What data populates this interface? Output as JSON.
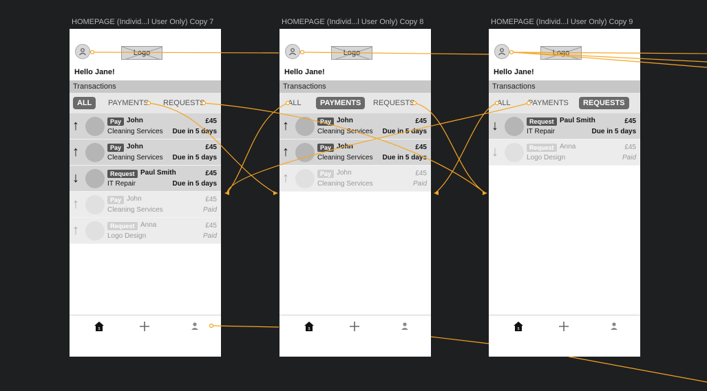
{
  "screens": [
    {
      "title": "HOMEPAGE (Individ...l User Only)  Copy 7",
      "logo": "Logo",
      "greeting": "Hello Jane!",
      "section": "Transactions",
      "tabs": [
        "ALL",
        "PAYMENTS",
        "REQUESTS"
      ],
      "active_tab": "ALL",
      "rows": [
        {
          "direction": "up",
          "type": "Pay",
          "name": "John",
          "service": "Cleaning Services",
          "amount": "£45",
          "status": "Due in 5 days",
          "muted": false
        },
        {
          "direction": "up",
          "type": "Pay",
          "name": "John",
          "service": "Cleaning Services",
          "amount": "£45",
          "status": "Due in 5 days",
          "muted": false
        },
        {
          "direction": "down",
          "type": "Request",
          "name": "Paul Smith",
          "service": "IT Repair",
          "amount": "£45",
          "status": "Due in 5 days",
          "muted": false
        },
        {
          "direction": "up",
          "type": "Pay",
          "name": "John",
          "service": "Cleaning Services",
          "amount": "£45",
          "status": "Paid",
          "muted": true
        },
        {
          "direction": "up",
          "type": "Request",
          "name": "Anna",
          "service": "Logo Design",
          "amount": "£45",
          "status": "Paid",
          "muted": true
        }
      ]
    },
    {
      "title": "HOMEPAGE (Individ...l User Only)  Copy 8",
      "logo": "Logo",
      "greeting": "Hello Jane!",
      "section": "Transactions",
      "tabs": [
        "ALL",
        "PAYMENTS",
        "REQUESTS"
      ],
      "active_tab": "PAYMENTS",
      "rows": [
        {
          "direction": "up",
          "type": "Pay",
          "name": "John",
          "service": "Cleaning Services",
          "amount": "£45",
          "status": "Due in 5 days",
          "muted": false
        },
        {
          "direction": "up",
          "type": "Pay",
          "name": "John",
          "service": "Cleaning Services",
          "amount": "£45",
          "status": "Due in 5 days",
          "muted": false
        },
        {
          "direction": "up",
          "type": "Pay",
          "name": "John",
          "service": "Cleaning Services",
          "amount": "£45",
          "status": "Paid",
          "muted": true
        }
      ]
    },
    {
      "title": "HOMEPAGE (Individ...l User Only)  Copy 9",
      "logo": "Logo",
      "greeting": "Hello Jane!",
      "section": "Transactions",
      "tabs": [
        "ALL",
        "PAYMENTS",
        "REQUESTS"
      ],
      "active_tab": "REQUESTS",
      "rows": [
        {
          "direction": "down",
          "type": "Request",
          "name": "Paul Smith",
          "service": "IT Repair",
          "amount": "£45",
          "status": "Due in 5 days",
          "muted": false
        },
        {
          "direction": "down",
          "type": "Request",
          "name": "Anna",
          "service": "Logo Design",
          "amount": "£45",
          "status": "Paid",
          "muted": true
        }
      ]
    }
  ],
  "nav_icons": [
    "home-icon",
    "plus-icon",
    "profile-icon"
  ],
  "colors": {
    "canvas": "#1e1f21",
    "link": "#f5a623",
    "active_tab": "#6a6a6a"
  }
}
